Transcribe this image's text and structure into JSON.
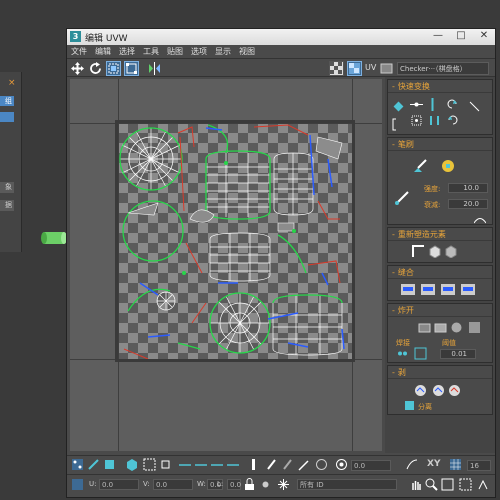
{
  "app": {
    "title": "编辑 UVW",
    "icon_label": "3",
    "window_buttons": [
      "—",
      "□",
      "✕"
    ]
  },
  "menu": [
    "文件",
    "编辑",
    "选择",
    "工具",
    "贴图",
    "选项",
    "显示",
    "视图"
  ],
  "toolbar": {
    "uv_label": "UV",
    "checker_dropdown": "Checker···（棋盘格）"
  },
  "left_panel": {
    "close_label": "×",
    "rows": [
      "组",
      "象",
      "据"
    ]
  },
  "right_panel": {
    "quick_transform": {
      "title": "快速变换",
      "toggle": "-"
    },
    "reshape": {
      "title": "笔刷",
      "toggle": "-",
      "strength_label": "强度:",
      "strength_value": "10.0",
      "falloff_label": "衰减:",
      "falloff_value": "20.0"
    },
    "rearrange": {
      "title": "重新塑造元素",
      "toggle": "-"
    },
    "stitch": {
      "title": "缝合",
      "toggle": "-"
    },
    "explode": {
      "title": "炸开",
      "toggle": "-",
      "weld_label": "焊接",
      "threshold_label": "阈值",
      "threshold_value": "0.01"
    },
    "peel": {
      "title": "剥",
      "toggle": "-",
      "detach_label": "分离"
    }
  },
  "bottom_bar1": {
    "rotation_value": "0.0",
    "xy_label": "XY",
    "grid_value": "16"
  },
  "bottom_bar2": {
    "u_label": "U:",
    "u_value": "0.0",
    "v_label": "V:",
    "v_value": "0.0",
    "w_label": "W:",
    "w_value": "0.0",
    "l_label": "L:",
    "l_value": "0.0",
    "id_dropdown": "所有 ID"
  },
  "colors": {
    "accent_orange": "#e9a53a",
    "selection_blue": "#3d6a94",
    "uv_wire": "#ffffff",
    "uv_seam_green": "#27d64a",
    "uv_edge_blue": "#2b5cff",
    "uv_edge_red": "#d93a2a"
  }
}
